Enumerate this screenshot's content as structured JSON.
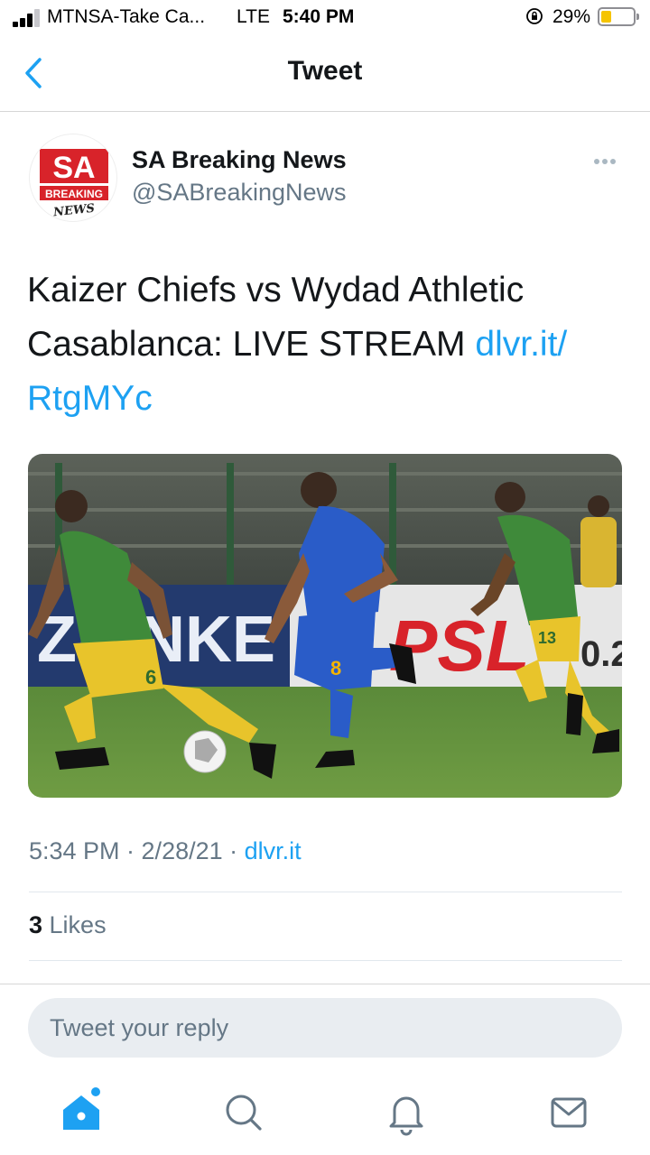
{
  "status_bar": {
    "carrier": "MTNSA-Take Ca...",
    "network": "LTE",
    "time": "5:40 PM",
    "battery_percent": "29%",
    "battery_level": 0.29,
    "battery_color": "#f5c400",
    "signal_bars": 3,
    "icons": [
      "signal-icon",
      "orientation-lock-icon",
      "battery-icon"
    ]
  },
  "nav": {
    "title": "Tweet",
    "back_icon": "chevron-left-icon",
    "accent_color": "#1da1f2"
  },
  "tweet": {
    "author": {
      "display_name": "SA Breaking News",
      "handle": "@SABreakingNews",
      "avatar_text_top": "SA",
      "avatar_text_band": "BREAKING",
      "avatar_text_bottom": "NEWS"
    },
    "text_plain": "Kaizer Chiefs vs Wydad Athletic Casablanca: LIVE STREAM ",
    "text_link_1": "dlvr.it/",
    "text_link_2": "RtgMYc",
    "media": {
      "ad_board_left": "ZE   NKE",
      "ad_board_right": "PSL",
      "ad_board_right2": "0.2",
      "player_number_left": "6",
      "player_number_center": "8",
      "player_number_right": "13"
    },
    "timestamp": "5:34 PM · 2/28/21 · ",
    "source": "dlvr.it",
    "likes_count": "3",
    "likes_label": " Likes"
  },
  "reply": {
    "placeholder": "Tweet your reply"
  },
  "tabbar": {
    "tabs": [
      "home-icon",
      "search-icon",
      "notifications-icon",
      "messages-icon"
    ],
    "active_color": "#1da1f2",
    "inactive_color": "#657786"
  }
}
